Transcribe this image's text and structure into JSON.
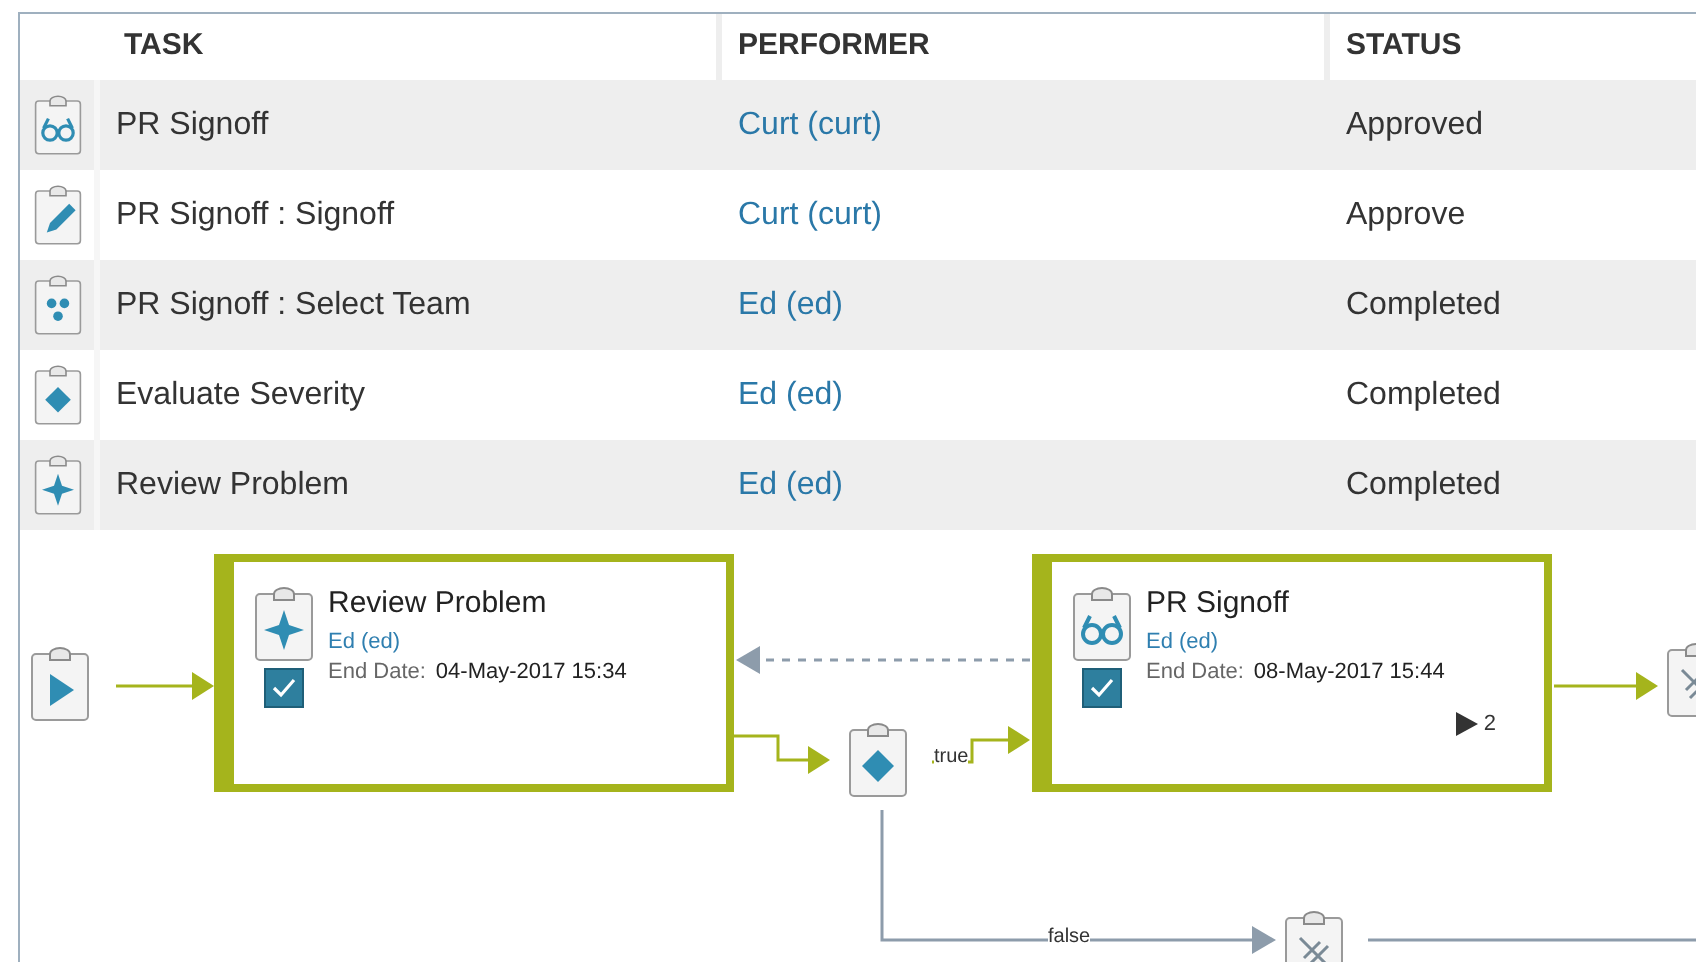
{
  "table": {
    "columns": [
      "TASK",
      "PERFORMER",
      "STATUS"
    ],
    "rows": [
      {
        "kind": "review",
        "task": "PR Signoff",
        "performer": "Curt (curt)",
        "status": "Approved"
      },
      {
        "kind": "edit",
        "task": "PR Signoff : Signoff",
        "performer": "Curt (curt)",
        "status": "Approve"
      },
      {
        "kind": "team",
        "task": "PR Signoff : Select Team",
        "performer": "Ed (ed)",
        "status": "Completed"
      },
      {
        "kind": "condition",
        "task": "Evaluate Severity",
        "performer": "Ed (ed)",
        "status": "Completed"
      },
      {
        "kind": "task",
        "task": "Review Problem",
        "performer": "Ed (ed)",
        "status": "Completed"
      }
    ]
  },
  "diagram": {
    "start": {
      "kind": "start"
    },
    "steps": [
      {
        "kind": "task",
        "title": "Review Problem",
        "performer": "Ed (ed)",
        "end_date_label": "End Date:",
        "end_date": "04-May-2017 15:34",
        "checked": true
      },
      {
        "kind": "review",
        "title": "PR Signoff",
        "performer": "Ed (ed)",
        "end_date_label": "End Date:",
        "end_date": "08-May-2017 15:44",
        "checked": true,
        "count": "2"
      }
    ],
    "condition": {
      "kind": "condition"
    },
    "edge_labels": [
      "true",
      "false"
    ],
    "next_nodes": [
      {
        "kind": "approve"
      },
      {
        "kind": "approve"
      }
    ]
  }
}
